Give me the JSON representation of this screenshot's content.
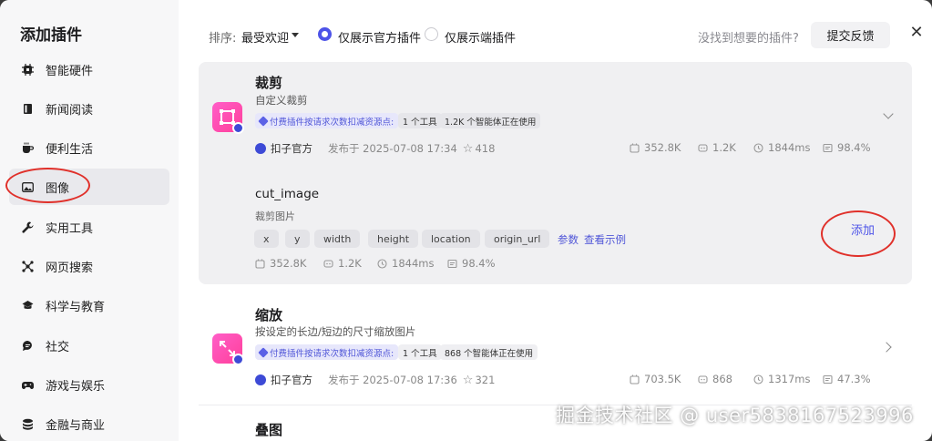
{
  "sidebar": {
    "title": "添加插件",
    "items": [
      {
        "label": "智能硬件",
        "icon": "chip-icon"
      },
      {
        "label": "新闻阅读",
        "icon": "book-icon"
      },
      {
        "label": "便利生活",
        "icon": "coffee-icon"
      },
      {
        "label": "图像",
        "icon": "image-icon",
        "active": true
      },
      {
        "label": "实用工具",
        "icon": "wrench-icon"
      },
      {
        "label": "网页搜索",
        "icon": "network-icon"
      },
      {
        "label": "科学与教育",
        "icon": "graduation-cap-icon"
      },
      {
        "label": "社交",
        "icon": "chat-icon"
      },
      {
        "label": "游戏与娱乐",
        "icon": "gamepad-icon"
      },
      {
        "label": "金融与商业",
        "icon": "coins-icon"
      }
    ]
  },
  "toolbar": {
    "sort_label": "排序:",
    "sort_value": "最受欢迎",
    "filter_official": "仅展示官方插件",
    "filter_client": "仅展示端插件",
    "selected_filter": "official",
    "help_text": "没找到想要的插件?",
    "feedback_label": "提交反馈"
  },
  "plugins": [
    {
      "title": "裁剪",
      "desc": "自定义裁剪",
      "paid_tag": "付费插件按请求次数扣减资源点:",
      "tools_count": "1 个工具",
      "agents_using": "1.2K 个智能体正在使用",
      "publisher": "扣子官方",
      "published": "发布于 2025-07-08 17:34",
      "stars": "418",
      "calls": "352.8K",
      "bots": "1.2K",
      "latency": "1844ms",
      "success": "98.4%",
      "tool": {
        "name": "cut_image",
        "desc": "裁剪图片",
        "params": [
          "x",
          "y",
          "width",
          "height",
          "location",
          "origin_url"
        ],
        "params_link": "参数",
        "example_link": "查看示例",
        "add_label": "添加",
        "calls": "352.8K",
        "bots": "1.2K",
        "latency": "1844ms",
        "success": "98.4%"
      }
    },
    {
      "title": "缩放",
      "desc": "按设定的长边/短边的尺寸缩放图片",
      "paid_tag": "付费插件按请求次数扣减资源点:",
      "tools_count": "1 个工具",
      "agents_using": "868 个智能体正在使用",
      "publisher": "扣子官方",
      "published": "发布于 2025-07-08 17:36",
      "stars": "321",
      "calls": "703.5K",
      "bots": "868",
      "latency": "1317ms",
      "success": "47.3%"
    },
    {
      "title": "叠图"
    }
  ],
  "watermark": "掘金技术社区 @ user5838167523996",
  "colors": {
    "accent": "#4d53e8",
    "plugin_icon": "#ff4fb0",
    "annotation": "#e0302a"
  }
}
